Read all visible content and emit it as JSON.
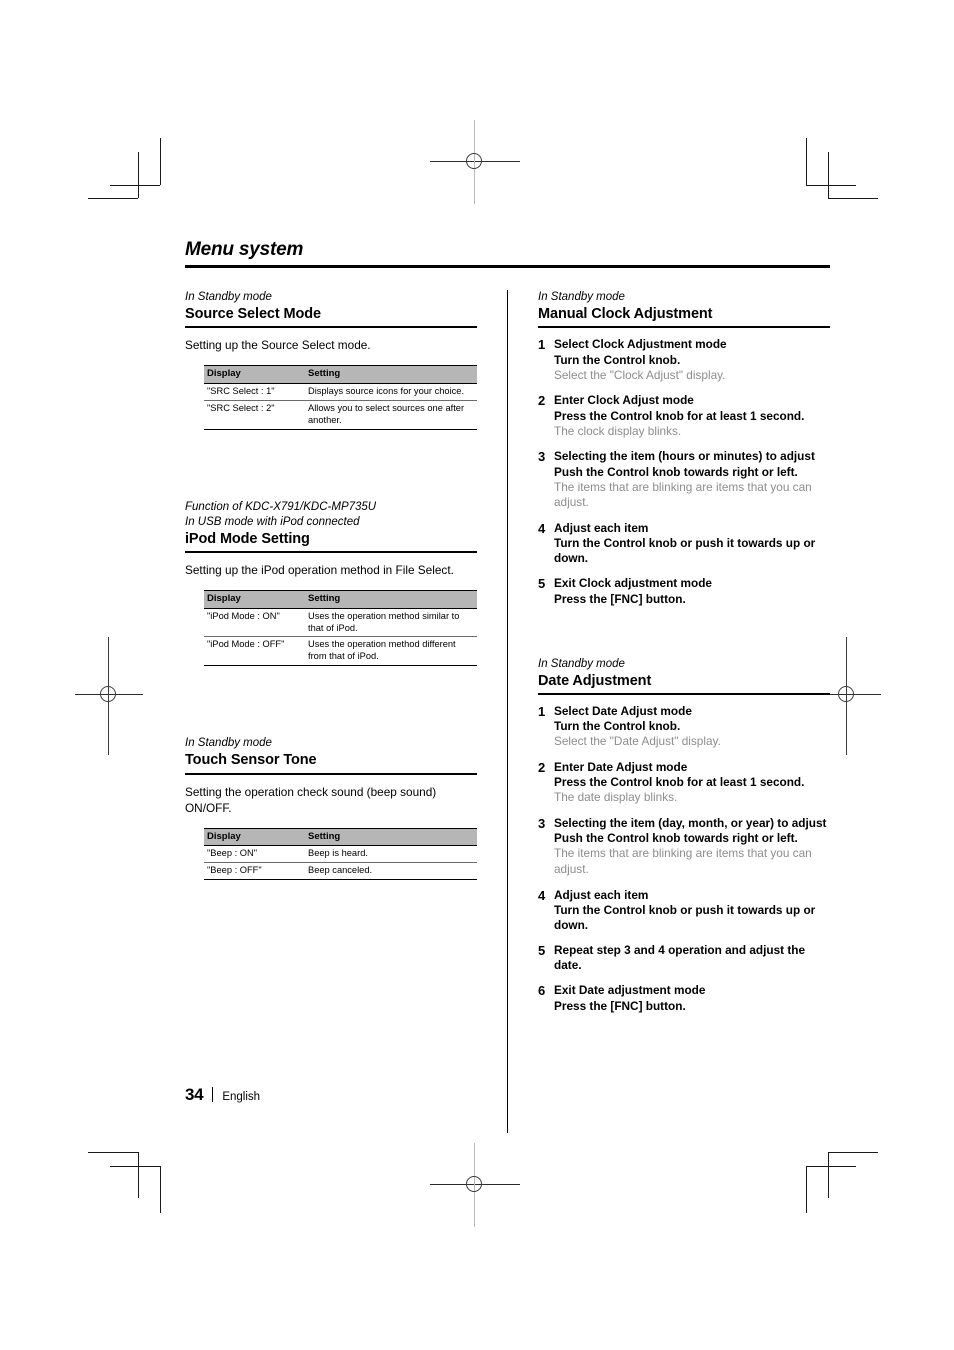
{
  "page": {
    "title": "Menu system",
    "folio": "34",
    "language": "English"
  },
  "table_headers": {
    "display": "Display",
    "setting": "Setting"
  },
  "left_column": {
    "sections": [
      {
        "kicker": "In Standby mode",
        "title": "Source Select Mode",
        "lead": "Setting up the Source Select mode.",
        "rows": [
          {
            "display": "\"SRC Select : 1\"",
            "setting": "Displays source icons for your choice."
          },
          {
            "display": "\"SRC Select : 2\"",
            "setting": "Allows you to select sources one after another."
          }
        ]
      },
      {
        "kicker": "Function of KDC-X791/KDC-MP735U\nIn USB mode with iPod connected",
        "title": "iPod Mode Setting",
        "lead": "Setting up the iPod operation method in File Select.",
        "rows": [
          {
            "display": "\"iPod Mode : ON\"",
            "setting": "Uses the operation method similar to that of iPod."
          },
          {
            "display": "\"iPod Mode : OFF\"",
            "setting": "Uses the operation method different from that of iPod."
          }
        ]
      },
      {
        "kicker": "In Standby mode",
        "title": "Touch Sensor Tone",
        "lead": "Setting the operation check sound (beep sound) ON/OFF.",
        "rows": [
          {
            "display": "\"Beep : ON\"",
            "setting": "Beep is heard."
          },
          {
            "display": "\"Beep : OFF\"",
            "setting": "Beep canceled."
          }
        ]
      }
    ]
  },
  "right_column": {
    "sections": [
      {
        "kicker": "In Standby mode",
        "title": "Manual Clock Adjustment",
        "steps": [
          {
            "num": "1",
            "title": "Select Clock Adjustment mode",
            "action": "Turn the Control knob.",
            "note": "Select the \"Clock Adjust\" display."
          },
          {
            "num": "2",
            "title": "Enter Clock Adjust mode",
            "action": "Press the Control knob for at least 1 second.",
            "note": "The clock display blinks."
          },
          {
            "num": "3",
            "title": "Selecting the item (hours or minutes) to adjust",
            "action": "Push the Control knob towards right or left.",
            "note": "The items that are blinking are items that you can adjust."
          },
          {
            "num": "4",
            "title": "Adjust each item",
            "action": "Turn the Control knob or push it towards up or down.",
            "note": ""
          },
          {
            "num": "5",
            "title": "Exit Clock adjustment mode",
            "action": "Press the [FNC] button.",
            "note": ""
          }
        ]
      },
      {
        "kicker": "In Standby mode",
        "title": "Date Adjustment",
        "steps": [
          {
            "num": "1",
            "title": "Select Date Adjust mode",
            "action": "Turn the Control knob.",
            "note": "Select the \"Date Adjust\" display."
          },
          {
            "num": "2",
            "title": "Enter Date Adjust mode",
            "action": "Press the Control knob for at least 1 second.",
            "note": "The date display blinks."
          },
          {
            "num": "3",
            "title": "Selecting the item (day, month, or year) to adjust",
            "action": "Push the Control knob towards right or left.",
            "note": "The items that are blinking are items that you can adjust."
          },
          {
            "num": "4",
            "title": "Adjust each item",
            "action": "Turn the Control knob or push it towards up or down.",
            "note": ""
          },
          {
            "num": "5",
            "title": "Repeat step 3 and 4 operation and adjust the date.",
            "action": "",
            "note": ""
          },
          {
            "num": "6",
            "title": "Exit Date adjustment mode",
            "action": "Press the [FNC] button.",
            "note": ""
          }
        ]
      }
    ]
  }
}
